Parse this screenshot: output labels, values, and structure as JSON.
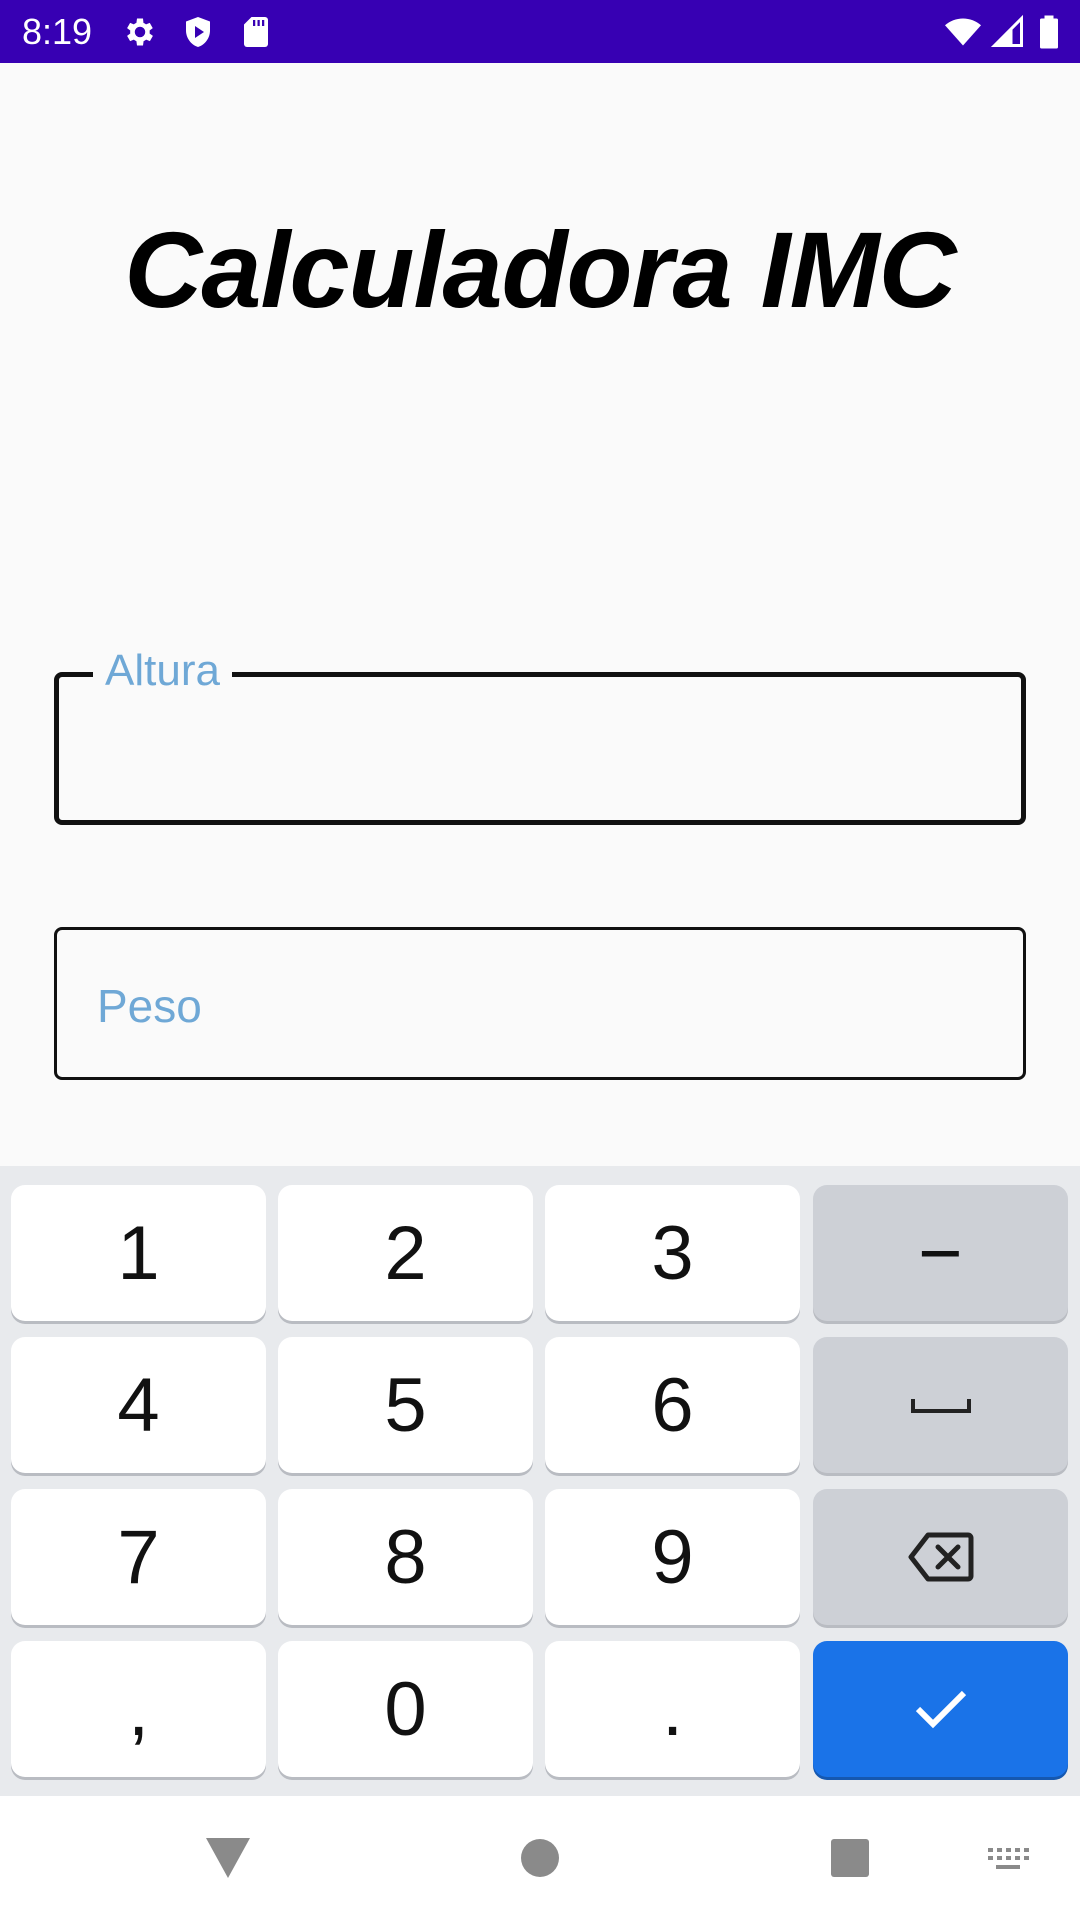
{
  "status_bar": {
    "time": "8:19",
    "icons_left": [
      "gear-icon",
      "shield-play-icon",
      "sd-card-icon"
    ],
    "icons_right": [
      "wifi-icon",
      "cell-signal-icon",
      "battery-icon"
    ],
    "background": "#3700b3"
  },
  "app": {
    "title": "Calculadora IMC",
    "fields": [
      {
        "label": "Altura",
        "value": "",
        "state": "focused"
      },
      {
        "label": "Peso",
        "value": "",
        "state": "idle"
      }
    ],
    "label_color": "#6fa8d6"
  },
  "keyboard": {
    "rows": [
      [
        "1",
        "2",
        "3",
        "−"
      ],
      [
        "4",
        "5",
        "6",
        "space"
      ],
      [
        "7",
        "8",
        "9",
        "backspace"
      ],
      [
        ",",
        "0",
        ".",
        "done"
      ]
    ],
    "accent": "#1a73e8"
  },
  "nav_bar": {
    "buttons": [
      "back-icon",
      "home-icon",
      "recents-icon",
      "keyboard-switch-icon"
    ]
  }
}
